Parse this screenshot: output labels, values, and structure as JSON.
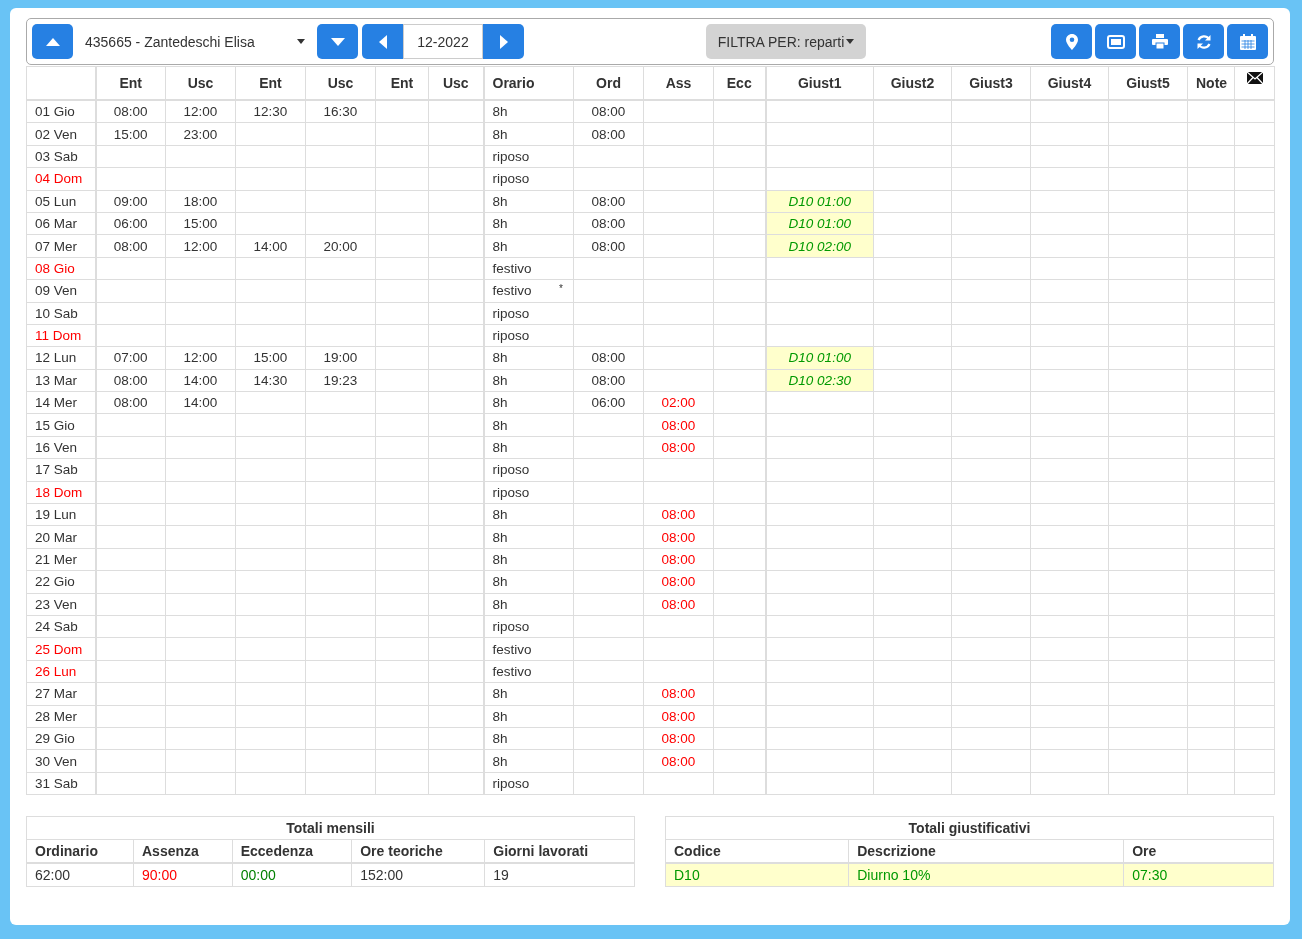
{
  "toolbar": {
    "employee": "435665 - Zantedeschi Elisa",
    "period": "12-2022",
    "filter": "FILTRA PER: reparti"
  },
  "table": {
    "columns": [
      "Ent",
      "Usc",
      "Ent",
      "Usc",
      "Ent",
      "Usc",
      "Orario",
      "Ord",
      "Ass",
      "Ecc",
      "Giust1",
      "Giust2",
      "Giust3",
      "Giust4",
      "Giust5",
      "Note"
    ],
    "rows": [
      {
        "day": "01 Gio",
        "holiday": false,
        "times": [
          "08:00",
          "12:00",
          "12:30",
          "16:30"
        ],
        "orario": "8h",
        "ord": "08:00"
      },
      {
        "day": "02 Ven",
        "holiday": false,
        "times": [
          "15:00",
          "23:00"
        ],
        "orario": "8h",
        "ord": "08:00"
      },
      {
        "day": "03 Sab",
        "holiday": false,
        "orario": "riposo"
      },
      {
        "day": "04 Dom",
        "holiday": true,
        "orario": "riposo"
      },
      {
        "day": "05 Lun",
        "holiday": false,
        "times": [
          "09:00",
          "18:00"
        ],
        "orario": "8h",
        "ord": "08:00",
        "giust1": "D10 01:00"
      },
      {
        "day": "06 Mar",
        "holiday": false,
        "times": [
          "06:00",
          "15:00"
        ],
        "orario": "8h",
        "ord": "08:00",
        "giust1": "D10 01:00"
      },
      {
        "day": "07 Mer",
        "holiday": false,
        "times": [
          "08:00",
          "12:00",
          "14:00",
          "20:00"
        ],
        "orario": "8h",
        "ord": "08:00",
        "giust1": "D10 02:00"
      },
      {
        "day": "08 Gio",
        "holiday": true,
        "orario": "festivo"
      },
      {
        "day": "09 Ven",
        "holiday": false,
        "orario": "festivo",
        "mark": "*"
      },
      {
        "day": "10 Sab",
        "holiday": false,
        "orario": "riposo"
      },
      {
        "day": "11 Dom",
        "holiday": true,
        "orario": "riposo"
      },
      {
        "day": "12 Lun",
        "holiday": false,
        "times": [
          "07:00",
          "12:00",
          "15:00",
          "19:00"
        ],
        "orario": "8h",
        "ord": "08:00",
        "giust1": "D10 01:00"
      },
      {
        "day": "13 Mar",
        "holiday": false,
        "times": [
          "08:00",
          "14:00",
          "14:30",
          "19:23"
        ],
        "orario": "8h",
        "ord": "08:00",
        "giust1": "D10 02:30"
      },
      {
        "day": "14 Mer",
        "holiday": false,
        "times": [
          "08:00",
          "14:00"
        ],
        "orario": "8h",
        "ord": "06:00",
        "ass": "02:00"
      },
      {
        "day": "15 Gio",
        "holiday": false,
        "orario": "8h",
        "ass": "08:00"
      },
      {
        "day": "16 Ven",
        "holiday": false,
        "orario": "8h",
        "ass": "08:00"
      },
      {
        "day": "17 Sab",
        "holiday": false,
        "orario": "riposo"
      },
      {
        "day": "18 Dom",
        "holiday": true,
        "orario": "riposo"
      },
      {
        "day": "19 Lun",
        "holiday": false,
        "orario": "8h",
        "ass": "08:00"
      },
      {
        "day": "20 Mar",
        "holiday": false,
        "orario": "8h",
        "ass": "08:00"
      },
      {
        "day": "21 Mer",
        "holiday": false,
        "orario": "8h",
        "ass": "08:00"
      },
      {
        "day": "22 Gio",
        "holiday": false,
        "orario": "8h",
        "ass": "08:00"
      },
      {
        "day": "23 Ven",
        "holiday": false,
        "orario": "8h",
        "ass": "08:00"
      },
      {
        "day": "24 Sab",
        "holiday": false,
        "orario": "riposo"
      },
      {
        "day": "25 Dom",
        "holiday": true,
        "orario": "festivo"
      },
      {
        "day": "26 Lun",
        "holiday": true,
        "orario": "festivo"
      },
      {
        "day": "27 Mar",
        "holiday": false,
        "orario": "8h",
        "ass": "08:00"
      },
      {
        "day": "28 Mer",
        "holiday": false,
        "orario": "8h",
        "ass": "08:00"
      },
      {
        "day": "29 Gio",
        "holiday": false,
        "orario": "8h",
        "ass": "08:00"
      },
      {
        "day": "30 Ven",
        "holiday": false,
        "orario": "8h",
        "ass": "08:00"
      },
      {
        "day": "31 Sab",
        "holiday": false,
        "orario": "riposo"
      }
    ]
  },
  "monthly_totals": {
    "title": "Totali mensili",
    "items": [
      {
        "label": "Ordinario",
        "value": "62:00",
        "color": "#333333"
      },
      {
        "label": "Assenza",
        "value": "90:00",
        "color": "#ff0000"
      },
      {
        "label": "Eccedenza",
        "value": "00:00",
        "color": "#008000"
      },
      {
        "label": "Ore teoriche",
        "value": "152:00",
        "color": "#333333"
      },
      {
        "label": "Giorni lavorati",
        "value": "19",
        "color": "#333333"
      }
    ]
  },
  "justification_totals": {
    "title": "Totali giustificativi",
    "columns": [
      "Codice",
      "Descrizione",
      "Ore"
    ],
    "rows": [
      [
        "D10",
        "Diurno 10%",
        "07:30"
      ]
    ]
  }
}
